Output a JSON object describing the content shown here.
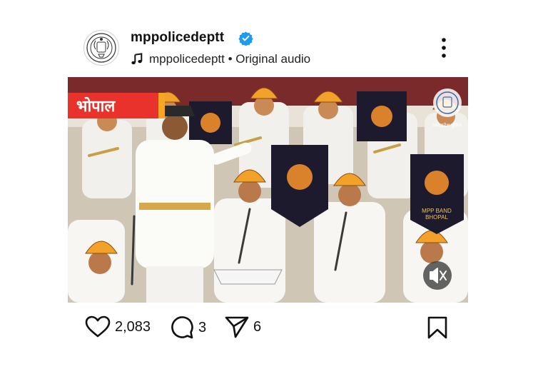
{
  "post": {
    "username": "mppolicedeptt",
    "audio_label": "mppolicedeptt • Original audio",
    "icons": {
      "avatar": "police-emblem-icon",
      "verified": "verified-badge-icon",
      "audio": "music-note-icon",
      "menu": "more-vertical-icon"
    }
  },
  "media": {
    "banner_text": "भोपाल",
    "banner_color": "#e8322b",
    "banner_accent": "#f5a623",
    "flag_text_line1": "MPP BAND",
    "flag_text_line2": "BHOPAL",
    "watermark_text": "मध्यप्रदेश पुलिस",
    "mute_icon": "speaker-muted-icon"
  },
  "actions": {
    "likes": "2,083",
    "comments": "3",
    "shares": "6",
    "icons": {
      "like": "heart-icon",
      "comment": "comment-bubble-icon",
      "share": "paper-plane-icon",
      "save": "bookmark-icon"
    }
  }
}
